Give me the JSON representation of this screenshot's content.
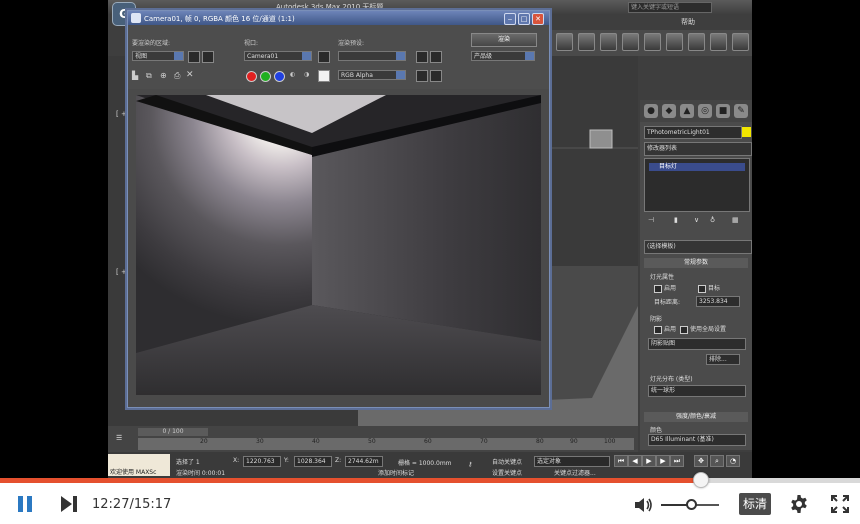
{
  "app": {
    "title": "Autodesk 3ds Max  2010    无标题",
    "logo_text": "G",
    "menu": [
      "帮助"
    ],
    "search_placeholder": "键入关键字或短语"
  },
  "render_window": {
    "title": "Camera01, 帧 0, RGBA 颜色 16 位/通道 (1:1)",
    "area_label": "要渲染的区域:",
    "area_value": "视图",
    "viewport_label": "视口:",
    "viewport_value": "Camera01",
    "preset_label": "渲染预设:",
    "preset_value": "",
    "render_button": "渲染",
    "product_value": "产品级",
    "channel_value": "RGB Alpha"
  },
  "viewport": {
    "labels": [
      "[ + ]",
      "[ + ]"
    ],
    "time_slider": "0 / 100",
    "ruler_ticks": [
      "20",
      "30",
      "40",
      "50",
      "60",
      "70",
      "80",
      "90",
      "100"
    ]
  },
  "command_panel": {
    "object_name": "TPhotometricLight01",
    "object_color": "#f2e600",
    "modifier_list": "修改器列表",
    "stack_item": "目标灯",
    "rollout_dropdown": "(选择模板)",
    "rollout_general": "常规参数",
    "light_props_label": "灯光属性",
    "enabled_label": "启用",
    "target_label": "目标",
    "target_distance_label": "目标距离:",
    "target_distance_value": "3253.834",
    "shadows_label": "阴影",
    "shadows_enabled": "启用",
    "global_settings": "使用全局设置",
    "shadow_type": "阴影贴图",
    "exclude_button": "排除...",
    "distribution_label": "灯光分布 (类型)",
    "distribution_value": "统一球形",
    "intensity_rollout": "强度/颜色/衰减",
    "color_label": "颜色",
    "color_value": "D65 Illuminant (基准)"
  },
  "status_bar": {
    "welcome_label": "欢迎使用 MAXSc",
    "selected_text": "选择了 1",
    "x_label": "X:",
    "x_value": "1220.763",
    "y_label": "Y:",
    "y_value": "1028.364",
    "z_label": "Z:",
    "z_value": "2744.62m",
    "grid_text": "栅格 = 1000.0mm",
    "autokey": "自动关键点",
    "selected_obj": "选定对象",
    "set_key": "设置关键点",
    "key_filter": "关键点过滤器...",
    "prompt_text": "渲染时间 0:00:01",
    "add_marker": "添加时间标记"
  },
  "player": {
    "current_time": "12:27",
    "total_time": "15:17",
    "progress": 0.815,
    "volume": 0.55,
    "quality_label": "标清",
    "accent_color": "#e5502e",
    "play_color": "#2b79c2",
    "icons": [
      "pause-icon",
      "next-icon",
      "volume-icon",
      "settings-icon",
      "fullscreen-icon"
    ]
  }
}
